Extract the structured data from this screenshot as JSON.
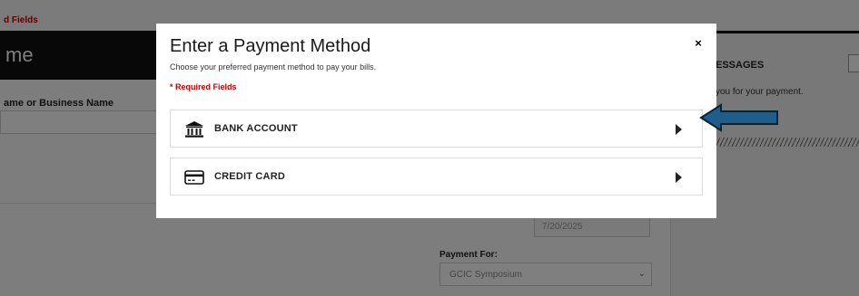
{
  "background": {
    "required_fields": "d Fields",
    "name_heading": "me",
    "business_label": "ame or Business Name",
    "messages_heading": "ESSAGES",
    "thanks_text": "you for your payment.",
    "date_value": "7/20/2025",
    "payment_for_label": "Payment For:",
    "payment_for_value": "GCIC Symposium"
  },
  "modal": {
    "title": "Enter a Payment Method",
    "subtitle": "Choose your preferred payment method to pay your bills.",
    "required_note": "* Required Fields",
    "close_label": "×",
    "options": [
      {
        "label": "BANK ACCOUNT",
        "icon": "bank-icon"
      },
      {
        "label": "CREDIT CARD",
        "icon": "credit-card-icon"
      }
    ]
  },
  "colors": {
    "required_red": "#c00000",
    "annotation_arrow": "#1f5d8a"
  }
}
